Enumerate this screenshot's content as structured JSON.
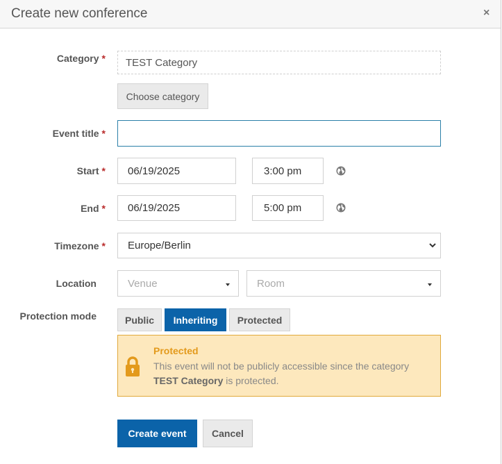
{
  "dialog": {
    "title": "Create new conference",
    "close_symbol": "×"
  },
  "form": {
    "category": {
      "label": "Category",
      "value": "TEST Category",
      "choose_button": "Choose category"
    },
    "event_title": {
      "label": "Event title",
      "value": ""
    },
    "start": {
      "label": "Start",
      "date": "06/19/2025",
      "time": "3:00 pm"
    },
    "end": {
      "label": "End",
      "date": "06/19/2025",
      "time": "5:00 pm"
    },
    "timezone": {
      "label": "Timezone",
      "value": "Europe/Berlin"
    },
    "location": {
      "label": "Location",
      "venue_placeholder": "Venue",
      "room_placeholder": "Room"
    },
    "protection": {
      "label": "Protection mode",
      "options": [
        "Public",
        "Inheriting",
        "Protected"
      ],
      "selected": "Inheriting",
      "warning_title": "Protected",
      "warning_text_1": "This event will not be publicly accessible since the category",
      "warning_category": "TEST Category",
      "warning_text_2": "is protected."
    },
    "required_marker": "*"
  },
  "actions": {
    "create": "Create event",
    "cancel": "Cancel"
  },
  "colors": {
    "primary": "#0b63a9",
    "required": "#b92b2b",
    "warning_bg": "#fde8bd",
    "warning_border": "#e0a93b",
    "warning_title": "#e39a1c"
  },
  "icons": {
    "globe": "globe-icon",
    "lock": "lock-icon",
    "close": "close-icon",
    "dropdown": "caret-down-icon"
  }
}
